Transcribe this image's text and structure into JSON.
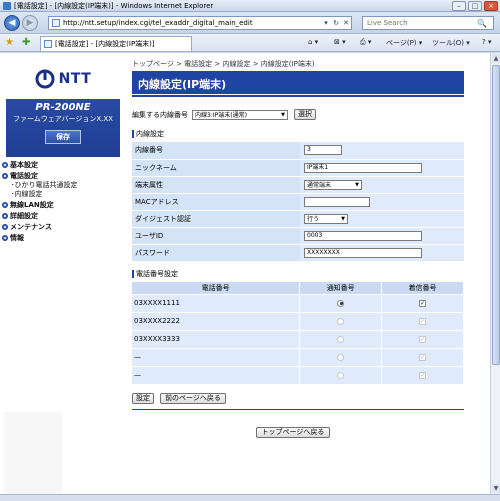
{
  "window": {
    "title": "[電話設定] - [内線設定(IP端末)] - Windows Internet Explorer",
    "minimize": "–",
    "maximize": "□",
    "close": "×"
  },
  "browser": {
    "back": "◀",
    "forward": "▶",
    "url": "http://ntt.setup/index.cgi/tel_exaddr_digital_main_edit",
    "refresh": "↻",
    "stop": "✕",
    "dropdown": "▾",
    "search_placeholder": "Live Search",
    "search_icon": "🔍",
    "tab_label": "[電話設定] - [内線設定(IP端末)]",
    "commands": {
      "home": "⌂ ▾",
      "feeds": "⊠ ▾",
      "print": "⎙ ▾",
      "page": "ページ(P) ▾",
      "tools": "ツール(O) ▾",
      "help": "? ▾"
    }
  },
  "sidebar": {
    "logo_text": "NTT",
    "model_name": "PR-200NE",
    "fw_version": "ファームウェアバージョンX.XX",
    "save_label": "保存",
    "menu": [
      {
        "label": "基本設定"
      },
      {
        "label": "電話設定",
        "sub": [
          "･ひかり電話共通設定",
          "･内線設定"
        ]
      },
      {
        "label": "無線LAN設定"
      },
      {
        "label": "詳細設定"
      },
      {
        "label": "メンテナンス"
      },
      {
        "label": "情報"
      }
    ]
  },
  "main": {
    "breadcrumb": "トップページ > 電話設定 > 内線設定 > 内線設定(IP端末)",
    "page_title": "内線設定(IP端末)",
    "ext_select": {
      "label": "編集する内線番号",
      "selected": "内線3:IP端末(通常)",
      "button": "選択"
    },
    "section_ext": "内線設定",
    "fields": {
      "ext_number": {
        "label": "内線番号",
        "value": "3"
      },
      "nickname": {
        "label": "ニックネーム",
        "value": "IP端末1"
      },
      "terminal_attr": {
        "label": "端末属性",
        "value": "通常端末"
      },
      "mac": {
        "label": "MACアドレス",
        "value": ""
      },
      "digest": {
        "label": "ダイジェスト認証",
        "value": "行う"
      },
      "user_id": {
        "label": "ユーザID",
        "value": "0003"
      },
      "password": {
        "label": "パスワード",
        "value": "XXXXXXXX"
      }
    },
    "section_phone": "電話番号設定",
    "phone_table": {
      "headers": [
        "電話番号",
        "通知番号",
        "着信番号"
      ],
      "rows": [
        {
          "number": "03XXXX1111",
          "notify": true,
          "incoming": true,
          "enabled": true
        },
        {
          "number": "03XXXX2222",
          "notify": false,
          "incoming": true,
          "enabled": false
        },
        {
          "number": "03XXXX3333",
          "notify": false,
          "incoming": true,
          "enabled": false
        },
        {
          "number": "—",
          "notify": false,
          "incoming": true,
          "enabled": false
        },
        {
          "number": "—",
          "notify": false,
          "incoming": true,
          "enabled": false
        }
      ]
    },
    "set_button": "設定",
    "back_button": "前のページへ戻る",
    "top_button": "トップページへ戻る"
  }
}
